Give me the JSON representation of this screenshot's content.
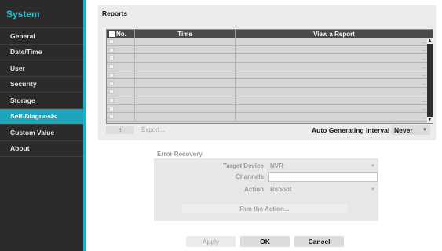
{
  "sidebar": {
    "title": "System",
    "items": [
      {
        "label": "General"
      },
      {
        "label": "Date/Time"
      },
      {
        "label": "User"
      },
      {
        "label": "Security"
      },
      {
        "label": "Storage"
      },
      {
        "label": "Self-Diagnosis",
        "active": true
      },
      {
        "label": "Custom Value"
      },
      {
        "label": "About"
      }
    ]
  },
  "reports": {
    "title": "Reports",
    "columns": {
      "no": "No.",
      "time": "Time",
      "view": "View a Report"
    },
    "row_dots": "...",
    "up_button_icon": "arrow-up-icon",
    "up_button_glyph": "↑",
    "export_label": "Export...",
    "auto_interval_label": "Auto Generating Interval",
    "auto_interval_value": "Never"
  },
  "error_recovery": {
    "title": "Error Recovery",
    "target_device_label": "Target Device",
    "target_device_value": "NVR",
    "channels_label": "Channels",
    "channels_value": "",
    "action_label": "Action",
    "action_value": "Reboot",
    "run_label": "Run the Action..."
  },
  "buttons": {
    "apply": "Apply",
    "ok": "OK",
    "cancel": "Cancel"
  },
  "colors": {
    "accent": "#1aa6b8",
    "sidebar_bg": "#2b2b2b",
    "title_accent": "#20c2d4"
  }
}
